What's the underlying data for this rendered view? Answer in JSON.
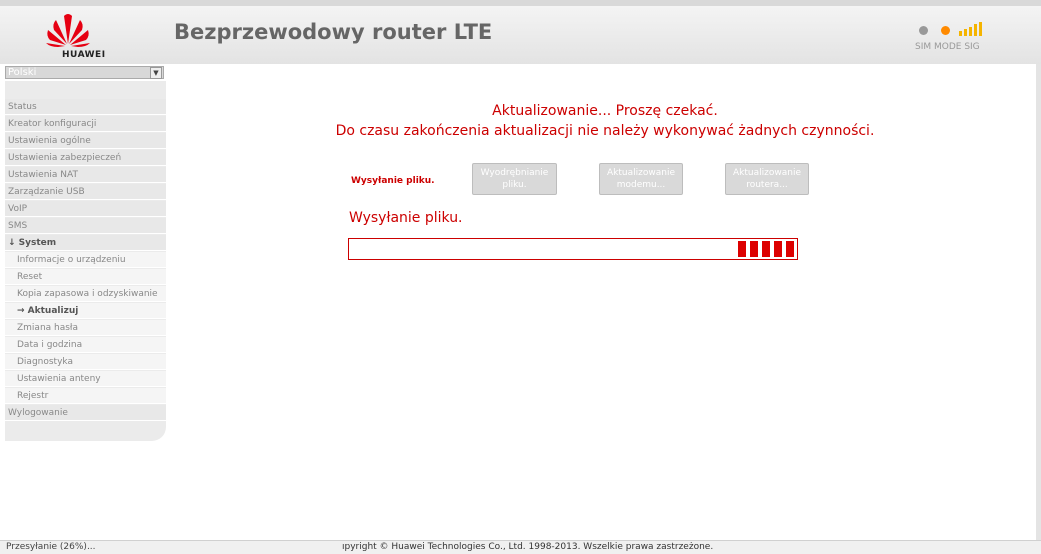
{
  "header": {
    "brand": "HUAWEI",
    "title": "Bezprzewodowy router LTE",
    "status_labels": "SIM MODE  SIG",
    "colors": {
      "sim": "#999999",
      "mode": "#ff8a00",
      "sig": "#f5b400"
    }
  },
  "sidebar": {
    "language": "Polski",
    "items": [
      {
        "label": "Status",
        "kind": "top"
      },
      {
        "label": "Kreator konfiguracji",
        "kind": "top"
      },
      {
        "label": "Ustawienia ogólne",
        "kind": "top"
      },
      {
        "label": "Ustawienia zabezpieczeń",
        "kind": "top"
      },
      {
        "label": "Ustawienia NAT",
        "kind": "top"
      },
      {
        "label": "Zarządzanie USB",
        "kind": "top"
      },
      {
        "label": "VoIP",
        "kind": "top"
      },
      {
        "label": "SMS",
        "kind": "top"
      },
      {
        "label": "↓ System",
        "kind": "top-active"
      },
      {
        "label": "Informacje o urządzeniu",
        "kind": "sub"
      },
      {
        "label": "Reset",
        "kind": "sub"
      },
      {
        "label": "Kopia zapasowa i odzyskiwanie",
        "kind": "sub"
      },
      {
        "label": "→ Aktualizuj",
        "kind": "sub-active"
      },
      {
        "label": "Zmiana hasła",
        "kind": "sub"
      },
      {
        "label": "Data i godzina",
        "kind": "sub"
      },
      {
        "label": "Diagnostyka",
        "kind": "sub"
      },
      {
        "label": "Ustawienia anteny",
        "kind": "sub"
      },
      {
        "label": "Rejestr",
        "kind": "sub"
      },
      {
        "label": "Wylogowanie",
        "kind": "top"
      }
    ]
  },
  "main": {
    "message_line1": "Aktualizowanie... Proszę czekać.",
    "message_line2": "Do czasu zakończenia aktualizacji nie należy wykonywać żadnych czynności.",
    "steps": {
      "current": "Wysyłanie pliku.",
      "step2_line1": "Wyodrębnianie",
      "step2_line2": "pliku.",
      "step3_line1": "Aktualizowanie",
      "step3_line2": "modemu...",
      "step4_line1": "Aktualizowanie",
      "step4_line2": "routera..."
    },
    "phase_label": "Wysyłanie pliku.",
    "progress_segments": 5,
    "accent_color": "#cc0000"
  },
  "footer": {
    "status": "Przesyłanie (26%)...",
    "copyright": "ıpyright © Huawei Technologies Co., Ltd. 1998-2013. Wszelkie prawa zastrzeżone."
  }
}
